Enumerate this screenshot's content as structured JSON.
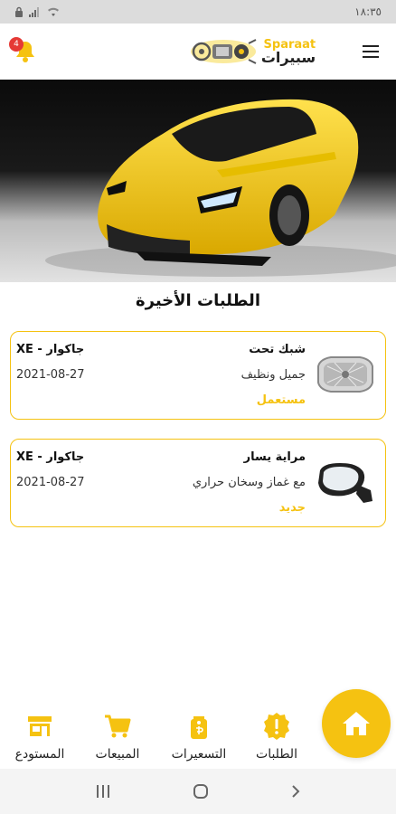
{
  "status_bar": {
    "time": "١٨:٣٥"
  },
  "header": {
    "notification_count": "4",
    "logo_en": "Sparaat",
    "logo_ar": "سبيرات",
    "menu_icon": "hamburger-menu-icon"
  },
  "section": {
    "title": "الطلبات الأخيرة"
  },
  "orders": [
    {
      "part": "شبك تحت",
      "description": "جميل ونظيف",
      "condition": "مستعمل",
      "car": "جاكوار - XE",
      "date": "2021-08-27",
      "icon": "grille-part-image"
    },
    {
      "part": "مراية يسار",
      "description": "مع غماز وسخان حراري",
      "condition": "جديد",
      "car": "جاكوار - XE",
      "date": "2021-08-27",
      "icon": "side-mirror-part-image"
    }
  ],
  "bottom_nav": {
    "orders": "الطلبات",
    "pricing": "التسعيرات",
    "sales": "المبيعات",
    "warehouse": "المستودع"
  },
  "colors": {
    "accent": "#f5c211",
    "badge": "#e53935"
  }
}
